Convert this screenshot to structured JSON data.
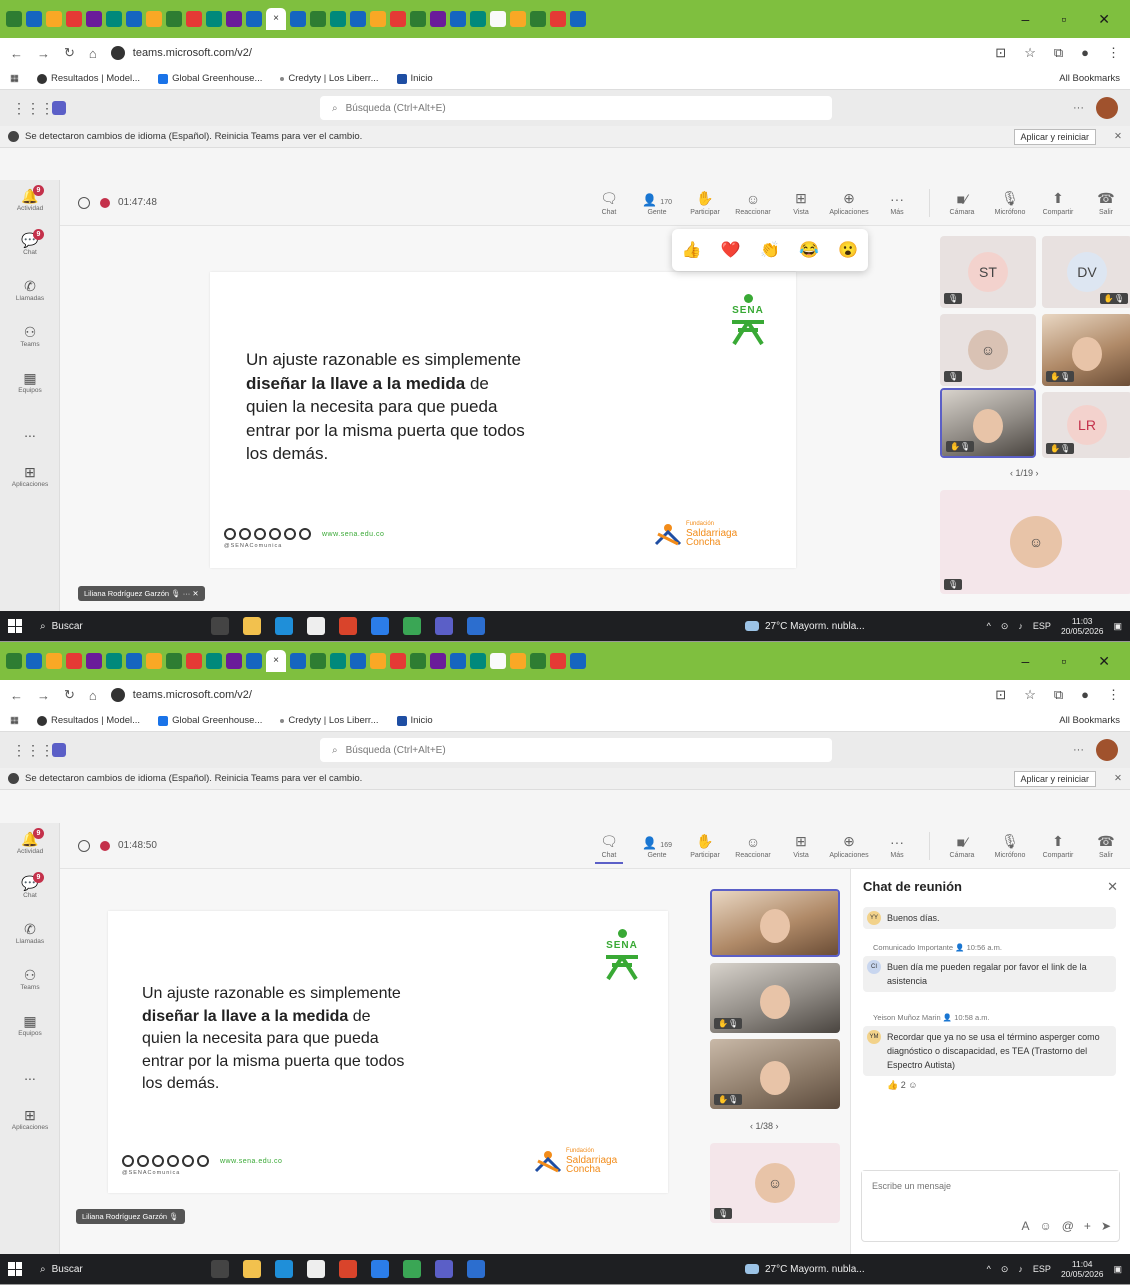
{
  "browser": {
    "url": "teams.microsoft.com/v2/",
    "bookmarks": [
      "Resultados | Model...",
      "Global Greenhouse...",
      "Credyty | Los Liberr...",
      "Inicio"
    ],
    "all_bookmarks": "All Bookmarks"
  },
  "teams": {
    "search_placeholder": "Búsqueda (Ctrl+Alt+E)",
    "notice": "Se detectaron cambios de idioma (Español). Reinicia Teams para ver el cambio.",
    "notice_button": "Aplicar y reiniciar",
    "rail": [
      {
        "label": "Actividad",
        "badge": "9"
      },
      {
        "label": "Chat",
        "badge": "9"
      },
      {
        "label": "Llamadas"
      },
      {
        "label": "Teams"
      },
      {
        "label": "Equipos"
      },
      {
        "label": "..."
      },
      {
        "label": "Aplicaciones"
      }
    ],
    "controls": {
      "chat": "Chat",
      "people": "Gente",
      "raise": "Participar",
      "react": "Reaccionar",
      "view": "Vista",
      "apps": "Aplicaciones",
      "more": "Más",
      "camera": "Cámara",
      "mic": "Micrófono",
      "share": "Compartir",
      "leave": "Salir"
    }
  },
  "shot1": {
    "timer": "01:47:48",
    "people_count": "170",
    "presenter": "Liliana Rodríguez Garzón",
    "pager": "1/19",
    "tiles": [
      "ST",
      "DV",
      "LR"
    ]
  },
  "shot2": {
    "timer": "01:48:50",
    "people_count": "169",
    "presenter": "Liliana Rodríguez Garzón",
    "pager": "1/38",
    "chat": {
      "title": "Chat de reunión",
      "messages": [
        {
          "initials": "YY",
          "text": "Buenos días."
        },
        {
          "author": "Comunicado Importante",
          "time": "10:56 a.m.",
          "initials": "CI",
          "text": "Buen día me pueden regalar por favor el link de la asistencia"
        },
        {
          "author": "Yeison Muñoz Marin",
          "time": "10:58 a.m.",
          "initials": "YM",
          "text": "Recordar que ya no se usa el término asperger como diagnóstico o discapacidad, es TEA (Trastorno del Espectro Autista)",
          "reactions": "2"
        }
      ],
      "compose_placeholder": "Escribe un mensaje"
    }
  },
  "slide": {
    "line1": "Un ajuste razonable es simplemente",
    "bold": "diseñar la llave a la medida",
    "after_bold": " de",
    "line3": "quien la necesita para que pueda",
    "line4": "entrar por la misma puerta que todos",
    "line5": "los demás.",
    "brand": "SENA",
    "website": "www.sena.edu.co",
    "handle": "@SENAComunica",
    "foundation_small": "Fundación",
    "foundation_name1": "Saldarriaga",
    "foundation_name2": "Concha"
  },
  "taskbar": {
    "search": "Buscar",
    "weather": "27°C Mayorm. nubla...",
    "clock1_time": "11:03",
    "clock2_time": "11:04",
    "date": "20/05/2026",
    "lang": "ESP"
  },
  "reactions": [
    "👍",
    "❤️",
    "👏",
    "😂",
    "😮"
  ]
}
